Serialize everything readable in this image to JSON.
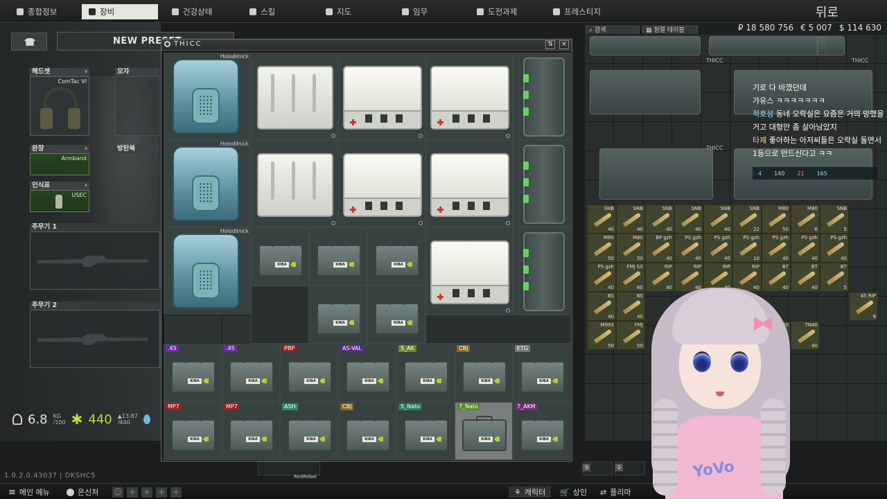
{
  "nav": {
    "tabs": [
      {
        "label": "종합정보",
        "icon": "overview-icon"
      },
      {
        "label": "장비",
        "icon": "gear-icon"
      },
      {
        "label": "건강상태",
        "icon": "health-icon"
      },
      {
        "label": "스킬",
        "icon": "skill-icon"
      },
      {
        "label": "지도",
        "icon": "map-icon"
      },
      {
        "label": "임무",
        "icon": "task-icon"
      },
      {
        "label": "도전과제",
        "icon": "achievement-icon"
      },
      {
        "label": "프레스티지",
        "icon": "prestige-icon"
      }
    ],
    "player_name": "뒤로"
  },
  "character": {
    "preset_title": "NEW PRESET",
    "slots": {
      "headset": {
        "label": "헤드셋",
        "item": "ComTac VI"
      },
      "helmet": {
        "label": "모자"
      },
      "armband": {
        "label": "완장",
        "item": "Armband"
      },
      "body_armor": {
        "label": "방탄복"
      },
      "dogtag": {
        "label": "인식표",
        "item": "USEC"
      },
      "primary": {
        "label": "주무기 1"
      },
      "primary2": {
        "label": "주무기 2"
      }
    },
    "stats": {
      "weight": "6.8",
      "weight_unit": "KG",
      "weight_max": "/100",
      "stamina": "440",
      "stamina_change": "▲13.87",
      "stamina_max": "/440"
    }
  },
  "version": "1.0.2.0.43037 | DKSHC5",
  "container": {
    "title": "THICC",
    "sort_icon": "sort-icon",
    "close_label": "×",
    "holodilnick_label": "Holodilnick",
    "rows": [
      {
        "tag": ".45",
        "color": "#6a2aa0"
      },
      {
        "tag": ".45",
        "color": "#6a2aa0"
      },
      {
        "tag": "PBP",
        "color": "#9a2020"
      },
      {
        "tag": "AS-VAL",
        "color": "#5a2a8a"
      },
      {
        "tag": "5_AK",
        "color": "#6a8a2a"
      },
      {
        "tag": "CBJ",
        "color": "#8a6a20"
      },
      {
        "tag": "ETG",
        "color": "#777777"
      },
      {
        "tag": "MP7",
        "color": "#9a2020"
      },
      {
        "tag": "MP7",
        "color": "#9a2020"
      },
      {
        "tag": "ASH",
        "color": "#2a8a6a"
      },
      {
        "tag": "CBJ",
        "color": "#8a6a20"
      },
      {
        "tag": "5_Nato",
        "color": "#2a7a5a"
      },
      {
        "tag": "7_Nato",
        "color": "#5a8a2a"
      },
      {
        "tag": "7_AKM",
        "color": "#7a2a7a"
      }
    ],
    "box_plate": "KIBA"
  },
  "stash": {
    "search_label": "검색",
    "sort_label": "정렬 테이블",
    "currency": {
      "roubles": "₽ 18 580 756",
      "euros": "€ 5 007",
      "dollars": "$ 114 630"
    },
    "thicc_label": "THICC",
    "ammo": [
      {
        "name": "SNB",
        "count": "40"
      },
      {
        "name": "SNB",
        "count": "40"
      },
      {
        "name": "SNB",
        "count": "40"
      },
      {
        "name": "SNB",
        "count": "40"
      },
      {
        "name": "SNB",
        "count": "40"
      },
      {
        "name": "SNB",
        "count": "22"
      },
      {
        "name": "M80",
        "count": "50"
      },
      {
        "name": "M80",
        "count": "6"
      },
      {
        "name": "SNB",
        "count": "5"
      },
      {
        "name": "M80",
        "count": "50"
      },
      {
        "name": "M80",
        "count": "50"
      },
      {
        "name": "BP gzh",
        "count": "40"
      },
      {
        "name": "PS gzh",
        "count": "40"
      },
      {
        "name": "PS gzh",
        "count": "40"
      },
      {
        "name": "PS gzh",
        "count": "10"
      },
      {
        "name": "PS gzh",
        "count": "40"
      },
      {
        "name": "PS gzh",
        "count": "40"
      },
      {
        "name": "PS gzh",
        "count": "40"
      },
      {
        "name": "PS gzh",
        "count": "40"
      },
      {
        "name": "FMJ SX",
        "count": "60"
      },
      {
        "name": "RIP",
        "count": "40"
      },
      {
        "name": "RIP",
        "count": "40"
      },
      {
        "name": "RIP",
        "count": "40"
      },
      {
        "name": "RIP",
        "count": "40"
      },
      {
        "name": "BT",
        "count": "40"
      },
      {
        "name": "BT",
        "count": "40"
      },
      {
        "name": "BT",
        "count": "5"
      },
      {
        "name": "BS",
        "count": "40"
      },
      {
        "name": "BS",
        "count": "40"
      },
      {
        "name": "45 RIP",
        "count": "9"
      },
      {
        "name": "M993",
        "count": "50"
      },
      {
        "name": "FMJ",
        "count": "50"
      },
      {
        "name": "7N40",
        "count": "40"
      },
      {
        "name": "7N40",
        "count": "40"
      }
    ],
    "chat": [
      {
        "user": "",
        "text": "기로 다 바꼈던데"
      },
      {
        "user": "",
        "text": "가유스 ㅋㅋㅋㅋㅋㅋㅋ"
      },
      {
        "user": "적호성",
        "text": "동네 오락실은 요즘은 거의 망했을거고 대형만 좀 살아남았지"
      },
      {
        "user": "타제",
        "text": "좋아하는 아저씨들은 오락실 돌면서 1등으로 만드신다고 ㅋㅋ"
      }
    ],
    "hideout": {
      "a": "4",
      "b": "140",
      "c": "21",
      "d": "165"
    }
  },
  "bottombar": {
    "menu": "메인 메뉴",
    "hideout": "은신처",
    "character": "캐릭터",
    "traders": "상인",
    "flea": "플리마"
  },
  "quickslots": {
    "slot9": "9",
    "slot0": "0",
    "owner": "RedRebel"
  },
  "overlay": {
    "hoodie_text": "YoVo"
  }
}
